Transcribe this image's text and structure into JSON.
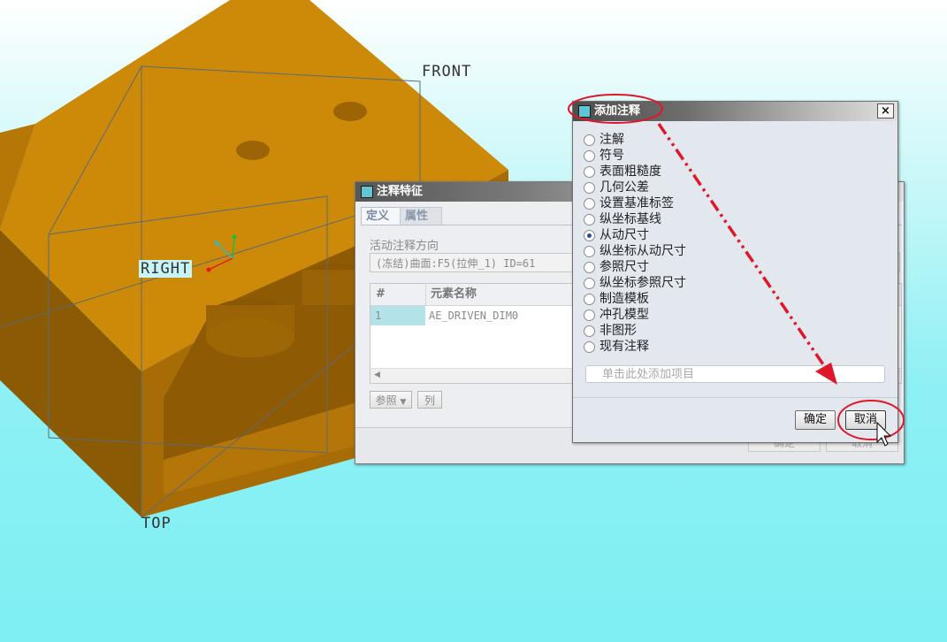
{
  "viewport": {
    "datum_labels": {
      "front": "FRONT",
      "right": "RIGHT",
      "top": "TOP"
    },
    "colors": {
      "model_top": "#cc8a08",
      "model_front": "#a66a05",
      "model_side": "#8a5804",
      "datum": "#5c6a78"
    }
  },
  "feature_dialog": {
    "title": "注释特征",
    "tabs": [
      "定义",
      "属性"
    ],
    "direction_label": "活动注释方向",
    "direction_value": "(冻结)曲面:F5(拉伸_1) ID=61",
    "table": {
      "headers": [
        "#",
        "元素名称"
      ],
      "rows": [
        {
          "index": "1",
          "name": "AE_DRIVEN_DIM0"
        }
      ]
    },
    "ref_button": "参照",
    "col_button": "列",
    "ok_button": "确定",
    "cancel_button": "取消"
  },
  "add_dialog": {
    "title": "添加注释",
    "close_glyph": "×",
    "options": [
      "注解",
      "符号",
      "表面粗糙度",
      "几何公差",
      "设置基准标签",
      "纵坐标基线",
      "从动尺寸",
      "纵坐标从动尺寸",
      "参照尺寸",
      "纵坐标参照尺寸",
      "制造模板",
      "冲孔模型",
      "非图形",
      "现有注释"
    ],
    "selected_option": "从动尺寸",
    "add_item_placeholder": "单击此处添加项目",
    "ok_button": "确定",
    "cancel_button": "取消"
  },
  "highlight_color": "#e0162a"
}
